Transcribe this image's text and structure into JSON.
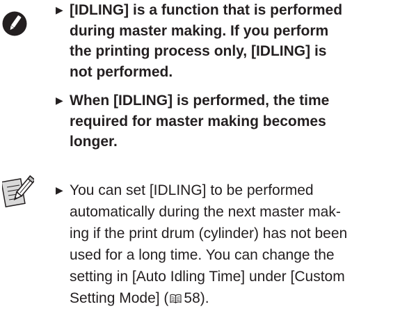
{
  "caution": {
    "icon": "caution-pencil-icon",
    "items": [
      {
        "text": "[IDLING] is a function that is performed\nduring master making. If you perform\nthe printing process only, [IDLING] is\nnot performed."
      },
      {
        "text": "When [IDLING] is performed, the time\nrequired for master making becomes\nlonger."
      }
    ]
  },
  "memo": {
    "icon": "memo-pencil-icon",
    "text_before": "You can set [IDLING] to be performed\nautomatically during the next master mak-\ning if the print drum (cylinder) has not been\nused for a long time. You can change the\nsetting in [Auto Idling Time] under [Custom\nSetting Mode] (",
    "page_ref_icon": "book-icon",
    "page_ref": "58",
    "text_after": ")."
  },
  "bullet_glyph": "▶"
}
